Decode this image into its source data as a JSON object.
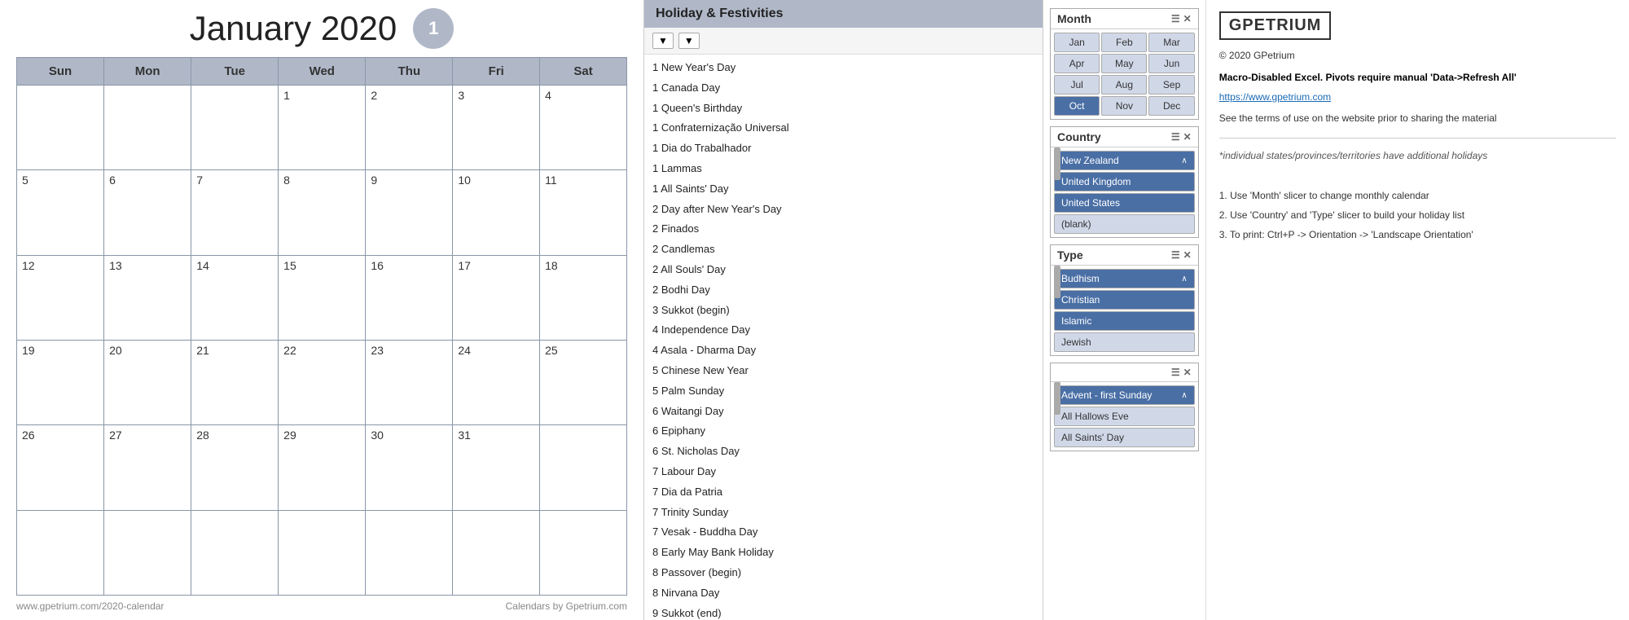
{
  "calendar": {
    "title": "January 2020",
    "badge": "1",
    "days_header": [
      "Sun",
      "Mon",
      "Tue",
      "Wed",
      "Thu",
      "Fri",
      "Sat"
    ],
    "weeks": [
      [
        null,
        null,
        null,
        1,
        2,
        3,
        4
      ],
      [
        5,
        6,
        7,
        8,
        9,
        10,
        11
      ],
      [
        12,
        13,
        14,
        15,
        16,
        17,
        18
      ],
      [
        19,
        20,
        21,
        22,
        23,
        24,
        25
      ],
      [
        26,
        27,
        28,
        29,
        30,
        31,
        null
      ],
      [
        null,
        null,
        null,
        null,
        null,
        null,
        null
      ]
    ],
    "footer_left": "www.gpetrium.com/2020-calendar",
    "footer_right": "Calendars by Gpetrium.com"
  },
  "holiday_panel": {
    "header": "Holiday & Festivities",
    "items": [
      "1  New Year's Day",
      "1  Canada Day",
      "1  Queen's Birthday",
      "1  Confraternização Universal",
      "1  Dia do Trabalhador",
      "1  Lammas",
      "1  All Saints' Day",
      "2  Day after New Year's Day",
      "2  Finados",
      "2  Candlemas",
      "2  All Souls' Day",
      "2  Bodhi Day",
      "3  Sukkot (begin)",
      "4  Independence Day",
      "4  Asala - Dharma Day",
      "5  Chinese New Year",
      "5  Palm Sunday",
      "6  Waitangi Day",
      "6  Epiphany",
      "6  St. Nicholas Day",
      "7  Labour Day",
      "7  Dia da Patria",
      "7  Trinity Sunday",
      "7  Vesak - Buddha Day",
      "8  Early May Bank Holiday",
      "8  Passover (begin)",
      "8  Nirvana Day",
      "9  Sukkot (end)"
    ]
  },
  "slicers": {
    "month": {
      "label": "Month",
      "months": [
        "Jan",
        "Feb",
        "Mar",
        "Apr",
        "May",
        "Jun",
        "Jul",
        "Aug",
        "Sep",
        "Oct",
        "Nov",
        "Dec"
      ],
      "active": "Oct"
    },
    "country": {
      "label": "Country",
      "items": [
        "New Zealand",
        "United Kingdom",
        "United States",
        "(blank)"
      ],
      "active": [
        "New Zealand",
        "United Kingdom",
        "United States"
      ]
    },
    "type": {
      "label": "Type",
      "items": [
        "Budhism",
        "Christian",
        "Islamic",
        "Jewish"
      ],
      "active": [
        "Budhism",
        "Christian",
        "Islamic"
      ]
    },
    "holiday_name": {
      "items": [
        "Advent - first Sunday",
        "All Hallows Eve",
        "All Saints' Day"
      ],
      "active": [
        "Advent - first Sunday"
      ]
    }
  },
  "info": {
    "logo": "GPETRIUM",
    "copyright": "© 2020 GPetrium",
    "warning": "Macro-Disabled Excel. Pivots require manual 'Data->Refresh All'",
    "link": "https://www.gpetrium.com",
    "terms": "See the terms of use on the website prior to sharing the material",
    "note": "*individual states/provinces/territories have additional holidays",
    "instructions": [
      "1. Use 'Month' slicer to change monthly calendar",
      "2. Use 'Country' and 'Type' slicer to build your holiday list",
      "3. To print: Ctrl+P -> Orientation -> 'Landscape Orientation'"
    ]
  }
}
